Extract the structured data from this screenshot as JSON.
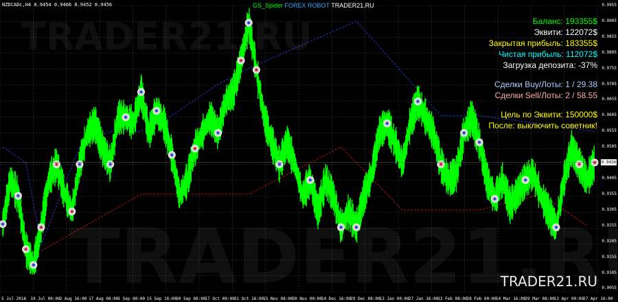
{
  "header": {
    "symbol_info": "NZDCADc,H4  0.9454 0.9466 0.9452 0.9456",
    "title_part1": "GS_Spider",
    "title_part2": "FOREX ROBOT",
    "title_part3": "TRADER21.RU"
  },
  "hud": {
    "balance": "Баланс: 193355$",
    "equity": "Эквити: 122072$",
    "closed_profit": "Закрытая прибыль: 183355$",
    "net_profit": "Чистая прибыль: 112072$",
    "deposit_load": "Загрузка депозита: -37%",
    "buy_trades": "Сделки Buy/Лоты: 1 / 29.38",
    "sell_trades": "Сделки Sell/Лоты: 2 / 58.55",
    "equity_target": "Цель по Эквити: 150000$",
    "after_text": "После: выключить советник!"
  },
  "colors": {
    "balance": "#00ff00",
    "equity": "#ffffff",
    "closed_profit": "#ffff00",
    "net_profit": "#00ffff",
    "deposit_load": "#ffffff",
    "buy_trades": "#aaccff",
    "sell_trades": "#ffaaaa",
    "equity_target": "#ffff00",
    "after_text": "#ffff00",
    "candles": "#00ff00",
    "buy_line": "#2233cc",
    "sell_line": "#bb1111"
  },
  "watermark": "TRADER21.RU",
  "background_marks": [
    "TRADER21.RU",
    "TRADER21.RU"
  ],
  "current_price": "0.9456",
  "chart_data": {
    "type": "line",
    "symbol": "NZDCADc",
    "timeframe": "H4",
    "ylim": [
      0.9045,
      0.9955
    ],
    "yticks": [
      "0.9955",
      "0.9905",
      "0.9855",
      "0.9805",
      "0.9755",
      "0.9705",
      "0.9655",
      "0.9605",
      "0.9555",
      "0.9505",
      "0.9455",
      "0.9405",
      "0.9355",
      "0.9305",
      "0.9255",
      "0.9205",
      "0.9155",
      "0.9105",
      "0.9055"
    ],
    "xticks": [
      "5 Jul 2016",
      "19 Jul 00:00",
      "2 Aug 16:00",
      "17 Aug 08:00",
      "1 Sep 00:00",
      "15 Sep 16:00",
      "30 Sep 08:00",
      "17 Oct 00:00",
      "31 Oct 16:00",
      "15 Nov 08:00",
      "30 Nov 00:00",
      "14 Dec 16:00",
      "29 Dec 08:00",
      "13 Jan 00:00",
      "27 Jan 16:00",
      "13 Feb 08:00",
      "28 Feb 00:00",
      "14 Mar 16:00",
      "29 Mar 08:00",
      "13 Apr 00:00",
      "27 Apr 16:00"
    ],
    "series": [
      {
        "values": [
          0.926,
          0.94,
          0.935,
          0.918,
          0.913,
          0.925,
          0.94,
          0.945,
          0.936,
          0.93,
          0.945,
          0.955,
          0.958,
          0.95,
          0.945,
          0.96,
          0.96,
          0.958,
          0.968,
          0.955,
          0.962,
          0.958,
          0.948,
          0.935,
          0.94,
          0.95,
          0.955,
          0.96,
          0.955,
          0.965,
          0.968,
          0.978,
          0.99,
          0.975,
          0.96,
          0.952,
          0.945,
          0.952,
          0.945,
          0.935,
          0.94,
          0.93,
          0.94,
          0.935,
          0.925,
          0.93,
          0.925,
          0.935,
          0.942,
          0.955,
          0.958,
          0.952,
          0.945,
          0.958,
          0.965,
          0.96,
          0.955,
          0.945,
          0.94,
          0.942,
          0.955,
          0.96,
          0.952,
          0.94,
          0.934,
          0.94,
          0.932,
          0.936,
          0.94,
          0.942,
          0.935,
          0.93,
          0.925,
          0.94,
          0.95,
          0.945,
          0.94,
          0.9456
        ]
      }
    ]
  }
}
